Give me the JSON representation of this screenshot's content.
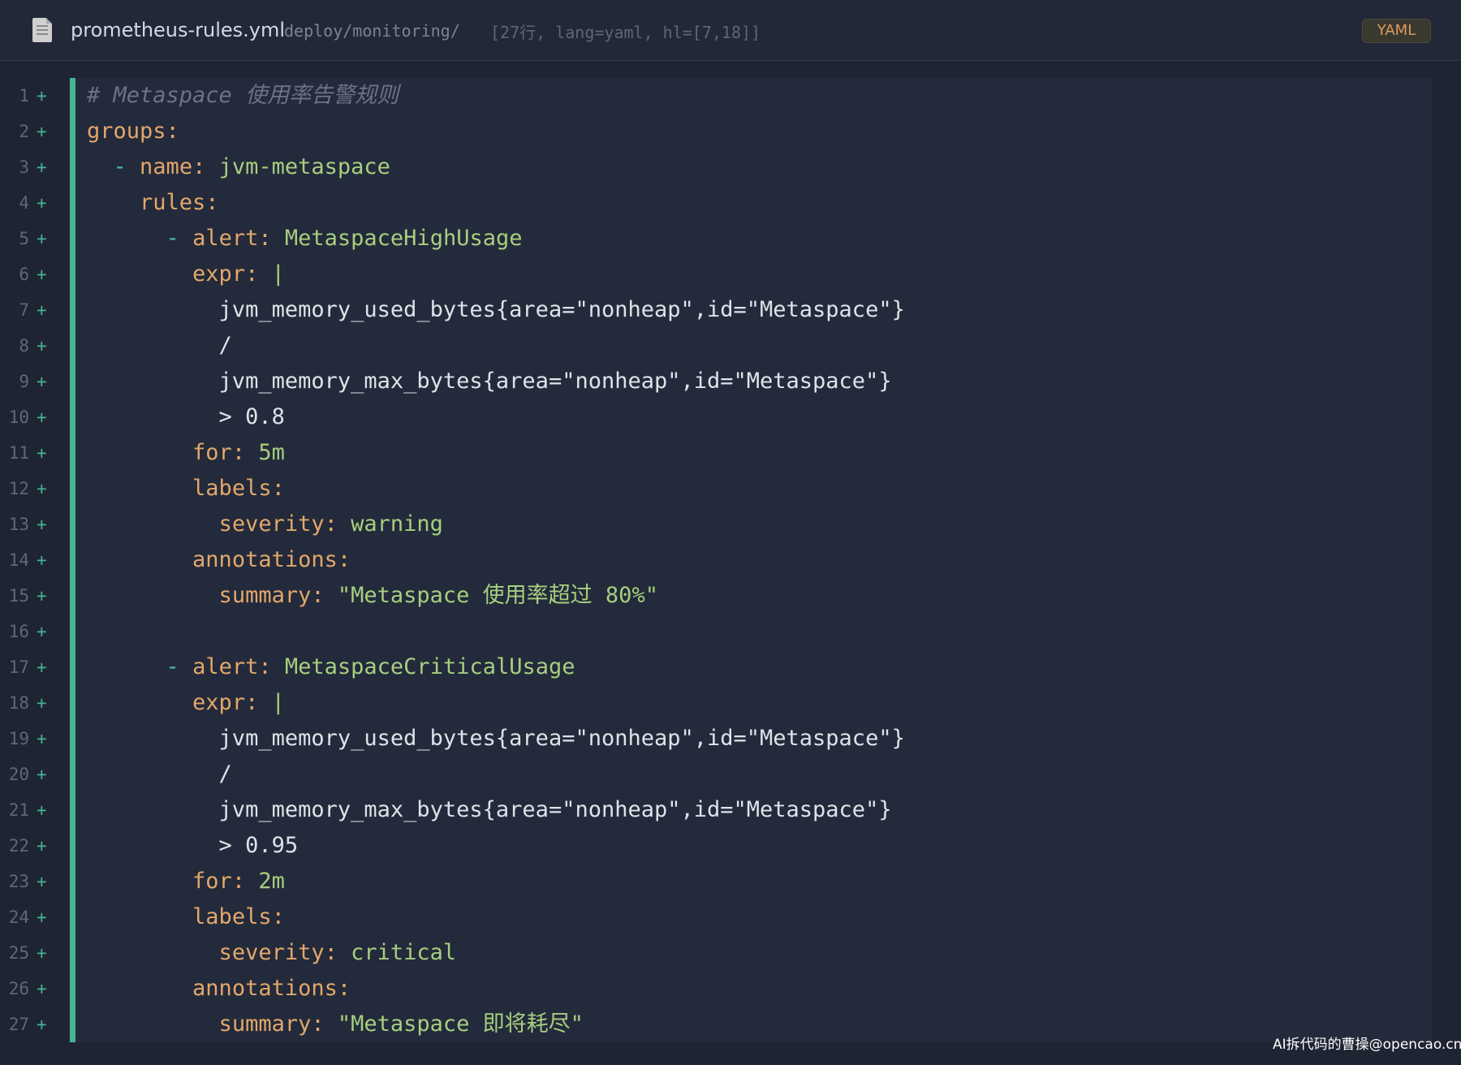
{
  "header": {
    "file_icon": "document-icon",
    "file_name": "prometheus-rules.yml",
    "file_path": "deploy/monitoring/",
    "file_meta": "[27行, lang=yaml, hl=[7,18]]",
    "language_badge": "YAML"
  },
  "code_lines": [
    {
      "n": "1",
      "mark": "+",
      "tokens": [
        {
          "t": "# Metaspace 使用率告警规则",
          "c": "comment"
        }
      ]
    },
    {
      "n": "2",
      "mark": "+",
      "tokens": [
        {
          "t": "groups:",
          "c": "key"
        }
      ]
    },
    {
      "n": "3",
      "mark": "+",
      "tokens": [
        {
          "t": "  ",
          "c": "plain"
        },
        {
          "t": "-",
          "c": "dash"
        },
        {
          "t": " ",
          "c": "plain"
        },
        {
          "t": "name:",
          "c": "key"
        },
        {
          "t": " jvm-metaspace",
          "c": "val"
        }
      ]
    },
    {
      "n": "4",
      "mark": "+",
      "tokens": [
        {
          "t": "    ",
          "c": "plain"
        },
        {
          "t": "rules:",
          "c": "key"
        }
      ]
    },
    {
      "n": "5",
      "mark": "+",
      "tokens": [
        {
          "t": "      ",
          "c": "plain"
        },
        {
          "t": "-",
          "c": "dash"
        },
        {
          "t": " ",
          "c": "plain"
        },
        {
          "t": "alert:",
          "c": "key"
        },
        {
          "t": " MetaspaceHighUsage",
          "c": "val"
        }
      ]
    },
    {
      "n": "6",
      "mark": "+",
      "tokens": [
        {
          "t": "        ",
          "c": "plain"
        },
        {
          "t": "expr:",
          "c": "key"
        },
        {
          "t": " |",
          "c": "pipe"
        }
      ]
    },
    {
      "n": "7",
      "mark": "+",
      "tokens": [
        {
          "t": "          jvm_memory_used_bytes{area=\"nonheap\",id=\"Metaspace\"}",
          "c": "plain"
        }
      ]
    },
    {
      "n": "8",
      "mark": "+",
      "tokens": [
        {
          "t": "          /",
          "c": "plain"
        }
      ]
    },
    {
      "n": "9",
      "mark": "+",
      "tokens": [
        {
          "t": "          jvm_memory_max_bytes{area=\"nonheap\",id=\"Metaspace\"}",
          "c": "plain"
        }
      ]
    },
    {
      "n": "10",
      "mark": "+",
      "tokens": [
        {
          "t": "          > 0.8",
          "c": "plain"
        }
      ]
    },
    {
      "n": "11",
      "mark": "+",
      "tokens": [
        {
          "t": "        ",
          "c": "plain"
        },
        {
          "t": "for:",
          "c": "key"
        },
        {
          "t": " 5m",
          "c": "val"
        }
      ]
    },
    {
      "n": "12",
      "mark": "+",
      "tokens": [
        {
          "t": "        ",
          "c": "plain"
        },
        {
          "t": "labels:",
          "c": "key"
        }
      ]
    },
    {
      "n": "13",
      "mark": "+",
      "tokens": [
        {
          "t": "          ",
          "c": "plain"
        },
        {
          "t": "severity:",
          "c": "key"
        },
        {
          "t": " warning",
          "c": "val"
        }
      ]
    },
    {
      "n": "14",
      "mark": "+",
      "tokens": [
        {
          "t": "        ",
          "c": "plain"
        },
        {
          "t": "annotations:",
          "c": "key"
        }
      ]
    },
    {
      "n": "15",
      "mark": "+",
      "tokens": [
        {
          "t": "          ",
          "c": "plain"
        },
        {
          "t": "summary:",
          "c": "key"
        },
        {
          "t": " \"Metaspace 使用率超过 80%\"",
          "c": "val"
        }
      ]
    },
    {
      "n": "16",
      "mark": "+",
      "tokens": []
    },
    {
      "n": "17",
      "mark": "+",
      "tokens": [
        {
          "t": "      ",
          "c": "plain"
        },
        {
          "t": "-",
          "c": "dash"
        },
        {
          "t": " ",
          "c": "plain"
        },
        {
          "t": "alert:",
          "c": "key"
        },
        {
          "t": " MetaspaceCriticalUsage",
          "c": "val"
        }
      ]
    },
    {
      "n": "18",
      "mark": "+",
      "tokens": [
        {
          "t": "        ",
          "c": "plain"
        },
        {
          "t": "expr:",
          "c": "key"
        },
        {
          "t": " |",
          "c": "pipe"
        }
      ]
    },
    {
      "n": "19",
      "mark": "+",
      "tokens": [
        {
          "t": "          jvm_memory_used_bytes{area=\"nonheap\",id=\"Metaspace\"}",
          "c": "plain"
        }
      ]
    },
    {
      "n": "20",
      "mark": "+",
      "tokens": [
        {
          "t": "          /",
          "c": "plain"
        }
      ]
    },
    {
      "n": "21",
      "mark": "+",
      "tokens": [
        {
          "t": "          jvm_memory_max_bytes{area=\"nonheap\",id=\"Metaspace\"}",
          "c": "plain"
        }
      ]
    },
    {
      "n": "22",
      "mark": "+",
      "tokens": [
        {
          "t": "          > 0.95",
          "c": "plain"
        }
      ]
    },
    {
      "n": "23",
      "mark": "+",
      "tokens": [
        {
          "t": "        ",
          "c": "plain"
        },
        {
          "t": "for:",
          "c": "key"
        },
        {
          "t": " 2m",
          "c": "val"
        }
      ]
    },
    {
      "n": "24",
      "mark": "+",
      "tokens": [
        {
          "t": "        ",
          "c": "plain"
        },
        {
          "t": "labels:",
          "c": "key"
        }
      ]
    },
    {
      "n": "25",
      "mark": "+",
      "tokens": [
        {
          "t": "          ",
          "c": "plain"
        },
        {
          "t": "severity:",
          "c": "key"
        },
        {
          "t": " critical",
          "c": "val"
        }
      ]
    },
    {
      "n": "26",
      "mark": "+",
      "tokens": [
        {
          "t": "        ",
          "c": "plain"
        },
        {
          "t": "annotations:",
          "c": "key"
        }
      ]
    },
    {
      "n": "27",
      "mark": "+",
      "tokens": [
        {
          "t": "          ",
          "c": "plain"
        },
        {
          "t": "summary:",
          "c": "key"
        },
        {
          "t": " \"Metaspace 即将耗尽\"",
          "c": "val"
        }
      ]
    }
  ],
  "watermark": "AI拆代码的曹操@opencao.cn",
  "colors": {
    "background": "#1f2433",
    "code_panel": "#232a3b",
    "accent": "#44b494",
    "key": "#e3a76a",
    "value": "#a6cf7f",
    "comment": "#6c7384"
  }
}
